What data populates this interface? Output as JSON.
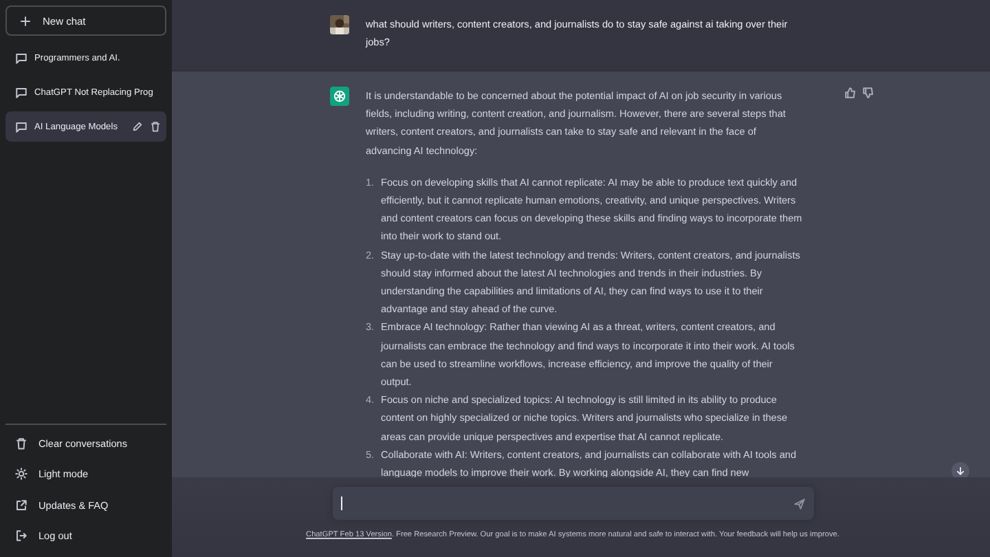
{
  "sidebar": {
    "new_chat": "New chat",
    "chats": [
      {
        "title": "Programmers and AI.",
        "selected": false
      },
      {
        "title": "ChatGPT Not Replacing Prog",
        "selected": false
      },
      {
        "title": "AI Language Models",
        "selected": true
      }
    ],
    "menu": [
      {
        "label": "Clear conversations",
        "kind": "trash"
      },
      {
        "label": "Light mode",
        "kind": "sun"
      },
      {
        "label": "Updates & FAQ",
        "kind": "external"
      },
      {
        "label": "Log out",
        "kind": "logout"
      }
    ]
  },
  "conversation": [
    {
      "kind": "user",
      "text": "what should writers, content creators, and journalists do to stay safe against ai taking over their jobs?"
    },
    {
      "kind": "assistant",
      "text": "It is understandable to be concerned about the potential impact of AI on job security in various fields, including writing, content creation, and journalism. However, there are several steps that writers, content creators, and journalists can take to stay safe and relevant in the face of advancing AI technology:",
      "items": [
        {
          "number": "1.",
          "text": "Focus on developing skills that AI cannot replicate: AI may be able to produce text quickly and efficiently, but it cannot replicate human emotions, creativity, and unique perspectives. Writers and content creators can focus on developing these skills and finding ways to incorporate them into their work to stand out."
        },
        {
          "number": "2.",
          "text": "Stay up-to-date with the latest technology and trends: Writers, content creators, and journalists should stay informed about the latest AI technologies and trends in their industries. By understanding the capabilities and limitations of AI, they can find ways to use it to their advantage and stay ahead of the curve."
        },
        {
          "number": "3.",
          "text": "Embrace AI technology: Rather than viewing AI as a threat, writers, content creators, and journalists can embrace the technology and find ways to incorporate it into their work. AI tools can be used to streamline workflows, increase efficiency, and improve the quality of their output."
        },
        {
          "number": "4.",
          "text": "Focus on niche and specialized topics: AI technology is still limited in its ability to produce content on highly specialized or niche topics. Writers and journalists who specialize in these areas can provide unique perspectives and expertise that AI cannot replicate."
        },
        {
          "number": "5.",
          "text": "Collaborate with AI: Writers, content creators, and journalists can collaborate with AI tools and language models to improve their work. By working alongside AI, they can find new"
        }
      ]
    }
  ],
  "footer": {
    "link": "ChatGPT Feb 13 Version",
    "text": ". Free Research Preview. Our goal is to make AI systems more natural and safe to interact with. Your feedback will help us improve."
  }
}
